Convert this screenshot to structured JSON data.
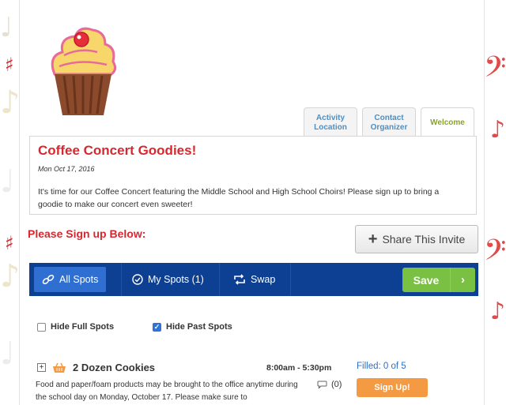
{
  "colors": {
    "accent_red": "#d7282f",
    "nav_blue": "#0d3f93",
    "nav_active": "#2e6fd1",
    "save_green": "#7ac143",
    "signup_orange": "#f39a43",
    "link_blue": "#2d6ec6"
  },
  "logo": {
    "icon": "cupcake-icon"
  },
  "tabs": [
    {
      "label": "Activity\nLocation",
      "active": false
    },
    {
      "label": "Contact\nOrganizer",
      "active": false
    },
    {
      "label": "Welcome",
      "active": true
    }
  ],
  "event": {
    "title": "Coffee Concert Goodies!",
    "date": "Mon Oct 17, 2016",
    "description": "It's time for our Coffee Concert featuring the Middle School and High School Choirs! Please sign up to bring a goodie to make our concert even sweeter!"
  },
  "signup": {
    "heading": "Please Sign up Below:",
    "share_label": "Share This Invite"
  },
  "navbar": {
    "all_spots": "All Spots",
    "my_spots": "My Spots (1)",
    "swap": "Swap",
    "save": "Save"
  },
  "filters": {
    "hide_full": {
      "label": "Hide Full Spots",
      "checked": false
    },
    "hide_past": {
      "label": "Hide Past Spots",
      "checked": true
    }
  },
  "spot": {
    "title": "2 Dozen Cookies",
    "time": "8:00am - 5:30pm",
    "filled": "Filled: 0 of 5",
    "description": "Food and paper/foam products may be brought to the office anytime during the school day on Monday, October 17.  Please make sure to",
    "comments": "(0)",
    "signup_label": "Sign Up!"
  }
}
